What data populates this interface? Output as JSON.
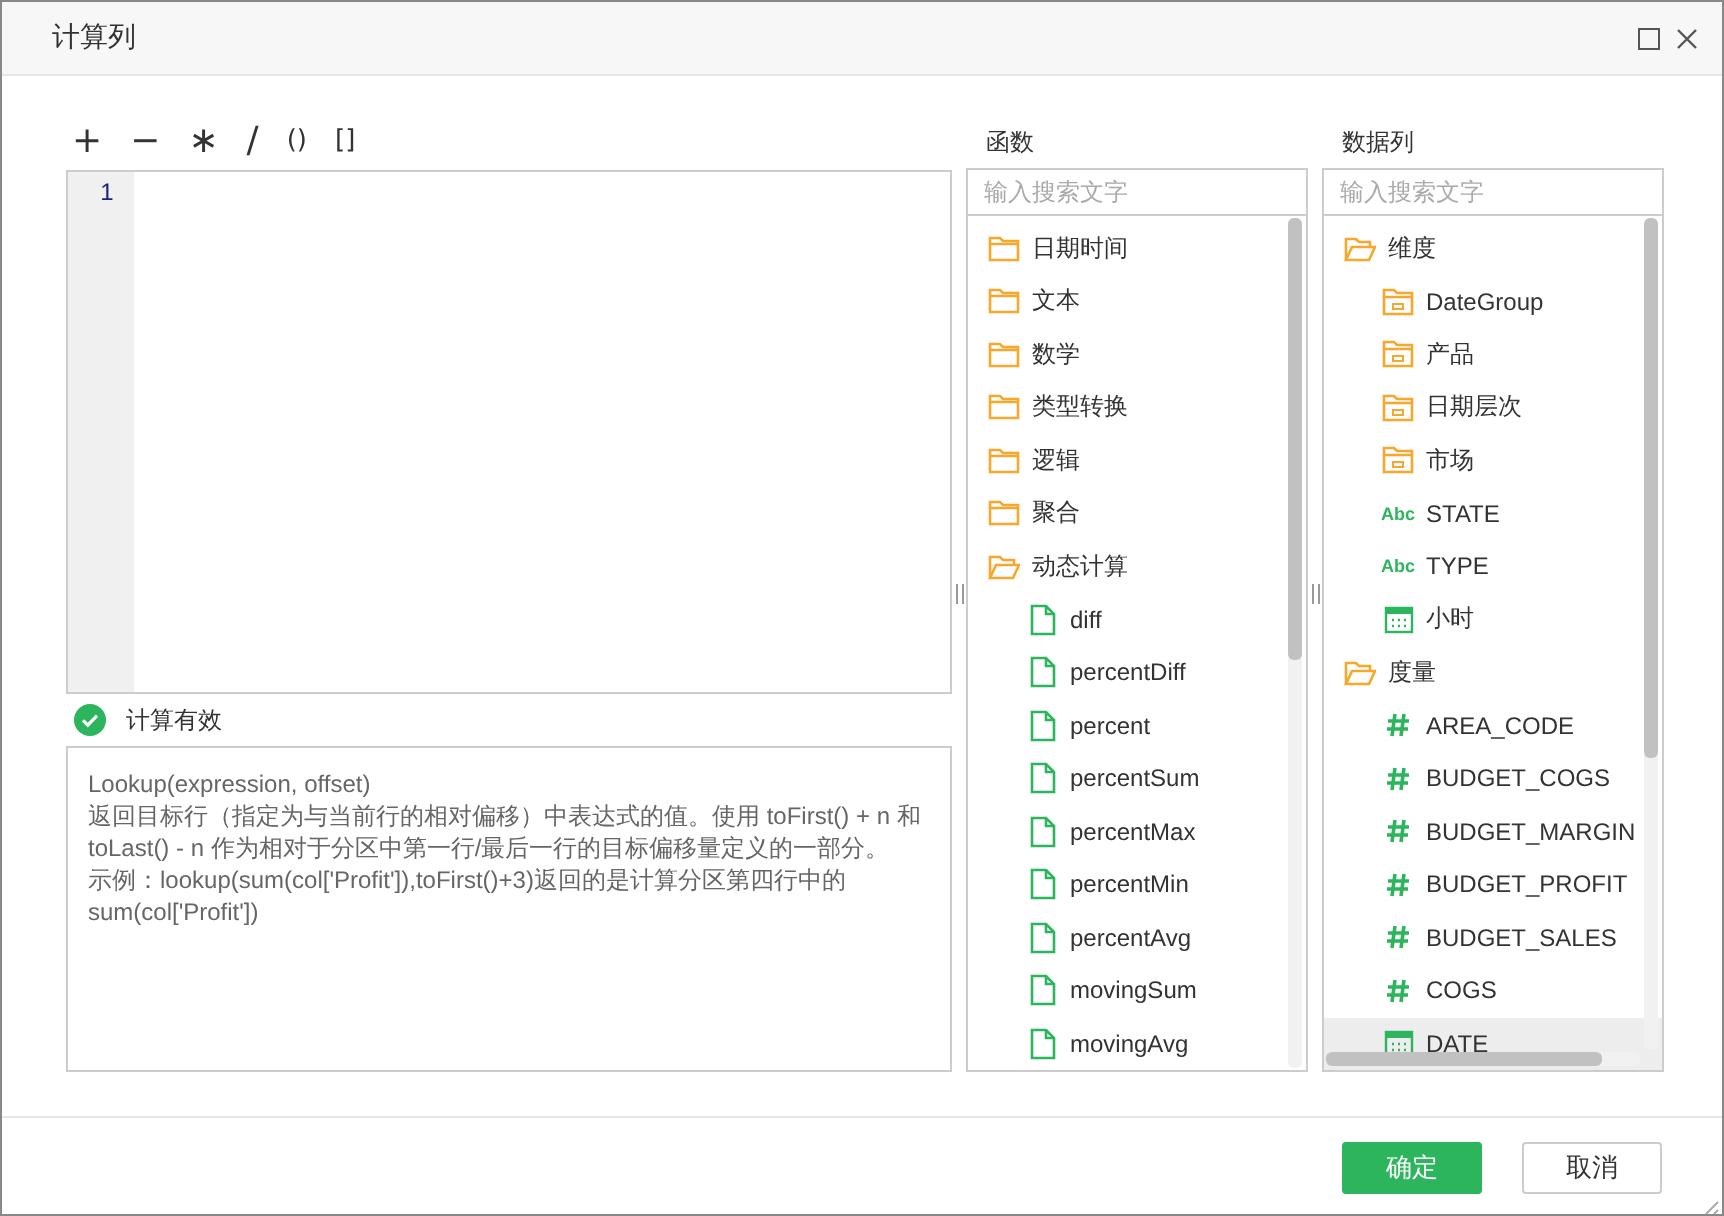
{
  "window": {
    "title": "计算列"
  },
  "operators": [
    "+",
    "−",
    "∗",
    "/",
    "()",
    "[]"
  ],
  "editor": {
    "line_numbers": [
      "1"
    ]
  },
  "validation": {
    "valid": true,
    "message": "计算有效"
  },
  "description": [
    "Lookup(expression, offset)",
    "返回目标行（指定为与当前行的相对偏移）中表达式的值。使用 toFirst() + n 和 toLast() - n 作为相对于分区中第一行/最后一行的目标偏移量定义的一部分。",
    "示例：lookup(sum(col['Profit']),toFirst()+3)返回的是计算分区第四行中的sum(col['Profit'])"
  ],
  "functions": {
    "label": "函数",
    "search": {
      "placeholder": "输入搜索文字"
    },
    "items": [
      {
        "kind": "folder",
        "label": "日期时间",
        "expanded": false
      },
      {
        "kind": "folder",
        "label": "文本",
        "expanded": false
      },
      {
        "kind": "folder",
        "label": "数学",
        "expanded": false
      },
      {
        "kind": "folder",
        "label": "类型转换",
        "expanded": false
      },
      {
        "kind": "folder",
        "label": "逻辑",
        "expanded": false
      },
      {
        "kind": "folder",
        "label": "聚合",
        "expanded": false
      },
      {
        "kind": "folder",
        "label": "动态计算",
        "expanded": true,
        "children": [
          {
            "kind": "function",
            "label": "diff"
          },
          {
            "kind": "function",
            "label": "percentDiff"
          },
          {
            "kind": "function",
            "label": "percent"
          },
          {
            "kind": "function",
            "label": "percentSum"
          },
          {
            "kind": "function",
            "label": "percentMax"
          },
          {
            "kind": "function",
            "label": "percentMin"
          },
          {
            "kind": "function",
            "label": "percentAvg"
          },
          {
            "kind": "function",
            "label": "movingSum"
          },
          {
            "kind": "function",
            "label": "movingAvg"
          }
        ]
      }
    ]
  },
  "data_columns": {
    "label": "数据列",
    "search": {
      "placeholder": "输入搜索文字"
    },
    "items": [
      {
        "kind": "folder",
        "label": "维度",
        "expanded": true,
        "children": [
          {
            "kind": "group",
            "label": "DateGroup",
            "selected": false
          },
          {
            "kind": "group",
            "label": "产品",
            "selected": false
          },
          {
            "kind": "group",
            "label": "日期层次",
            "selected": false
          },
          {
            "kind": "group",
            "label": "市场",
            "selected": false
          },
          {
            "kind": "text",
            "badge": "Abc",
            "label": "STATE",
            "selected": false
          },
          {
            "kind": "text",
            "badge": "Abc",
            "label": "TYPE",
            "selected": false
          },
          {
            "kind": "date",
            "label": "小时",
            "selected": false
          }
        ]
      },
      {
        "kind": "folder",
        "label": "度量",
        "expanded": true,
        "children": [
          {
            "kind": "number",
            "label": "AREA_CODE",
            "selected": false
          },
          {
            "kind": "number",
            "label": "BUDGET_COGS",
            "selected": false
          },
          {
            "kind": "number",
            "label": "BUDGET_MARGIN",
            "selected": false
          },
          {
            "kind": "number",
            "label": "BUDGET_PROFIT",
            "selected": false
          },
          {
            "kind": "number",
            "label": "BUDGET_SALES",
            "selected": false
          },
          {
            "kind": "number",
            "label": "COGS",
            "selected": false
          },
          {
            "kind": "date",
            "label": "DATE",
            "selected": true
          }
        ]
      }
    ]
  },
  "buttons": [
    {
      "kind": "primary",
      "label": "确定"
    },
    {
      "kind": "secondary",
      "label": "取消"
    }
  ]
}
